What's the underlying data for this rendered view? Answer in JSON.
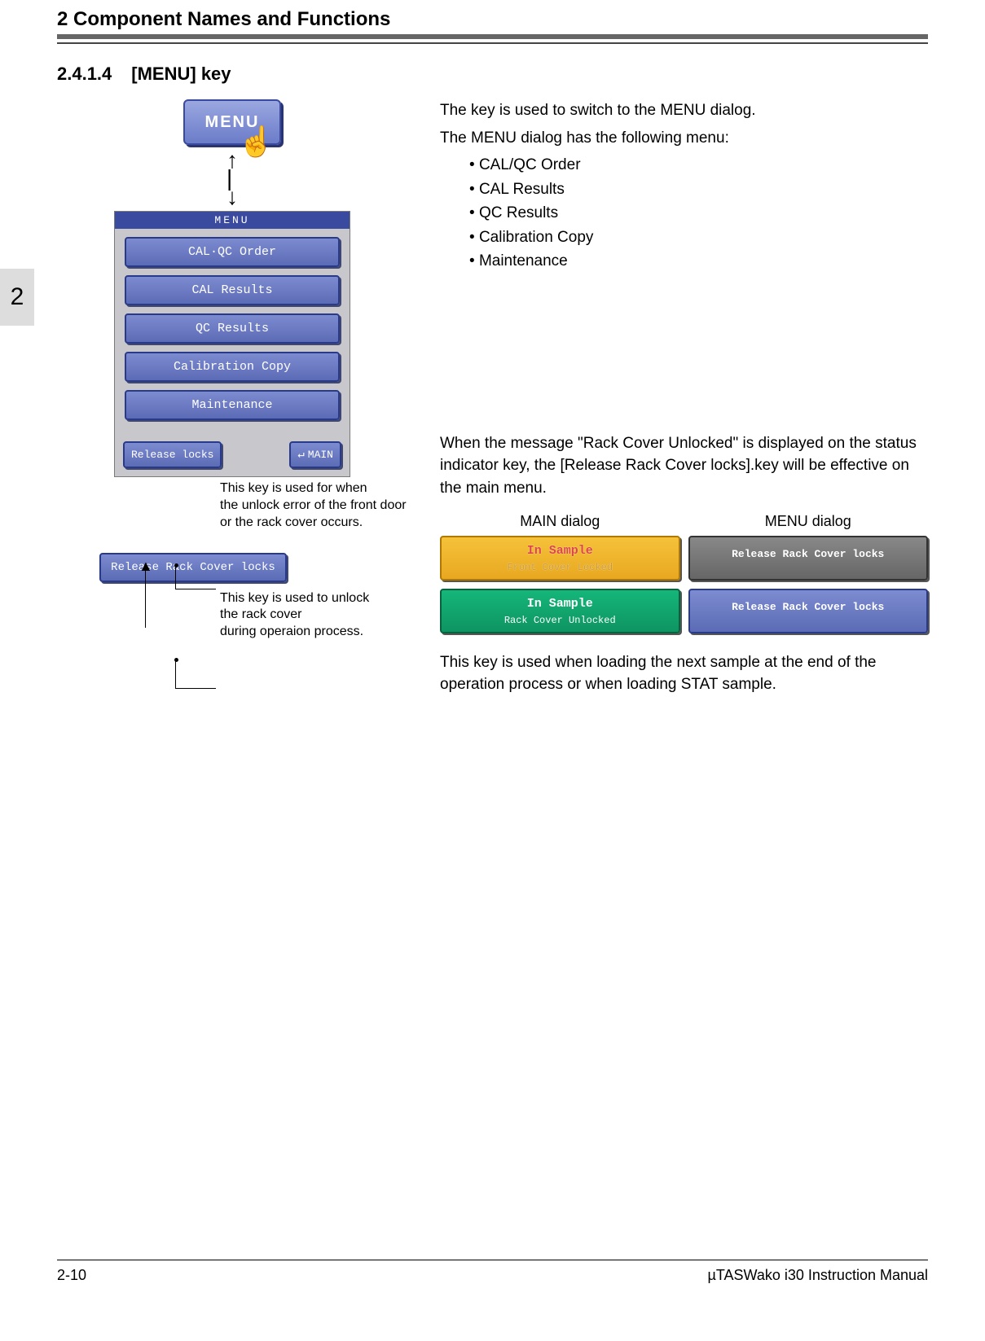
{
  "chapter_title": "2 Component Names and Functions",
  "section": {
    "number": "2.4.1.4",
    "title": "[MENU] key"
  },
  "side_tab": "2",
  "menu_key_label": "MENU",
  "panel": {
    "header": "MENU",
    "items": [
      "CAL·QC Order",
      "CAL Results",
      "QC Results",
      "Calibration Copy",
      "Maintenance"
    ],
    "footer_left": "Release locks",
    "footer_right": "MAIN"
  },
  "caption1_l1": "This key is used for when",
  "caption1_l2": "the unlock error of the front door",
  "caption1_l3": "or the rack cover occurs.",
  "release_rack_label": "Release Rack Cover locks",
  "caption2_l1": "This key is used to unlock",
  "caption2_l2": "the rack cover",
  "caption2_l3": "during operaion process.",
  "intro_p1": "The key is used to switch to the MENU dialog.",
  "intro_p2": "The MENU dialog has the following menu:",
  "bullets": [
    "CAL/QC Order",
    "CAL Results",
    "QC Results",
    "Calibration Copy",
    "Maintenance"
  ],
  "rack_p1": "When the message \"Rack Cover Unlocked\" is displayed on the status indicator key, the [Release Rack Cover locks].key will be effective on the main menu.",
  "dialog_labels": {
    "left": "MAIN dialog",
    "right": "MENU dialog"
  },
  "status": {
    "yellow": {
      "t1": "In Sample",
      "t2": "Front Cover Locked"
    },
    "grey": {
      "t1": "Release Rack Cover locks"
    },
    "green": {
      "t1": "In Sample",
      "t2": "Rack Cover Unlocked"
    },
    "blue": {
      "t1": "Release Rack Cover locks"
    }
  },
  "after_note": "This key is used when loading the next sample at the end of the operation process or when loading STAT sample.",
  "footer": {
    "left": "2-10",
    "right": "µTASWako i30  Instruction Manual"
  }
}
